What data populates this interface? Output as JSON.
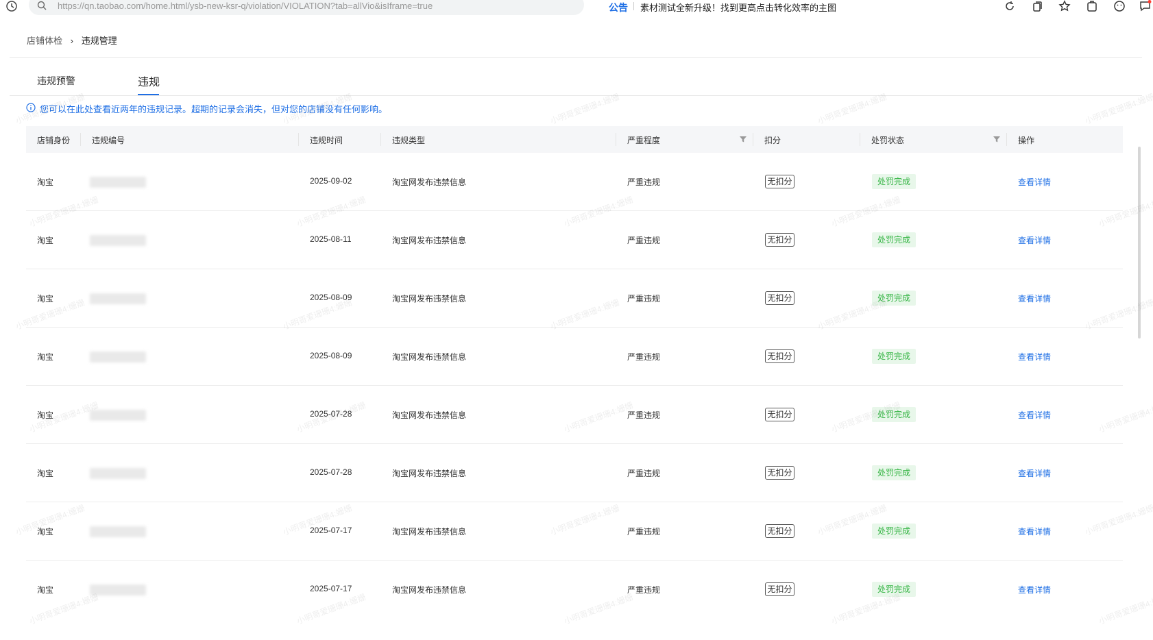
{
  "browser": {
    "url": "https://qn.taobao.com/home.html/ysb-new-ksr-q/violation/VIOLATION?tab=allVio&isIframe=true",
    "notice_label": "公告",
    "notice_text": "素材测试全新升级！找到更高点击转化效率的主图"
  },
  "breadcrumb": {
    "root": "店铺体检",
    "separator": "›",
    "current": "违规管理"
  },
  "tabs": [
    {
      "label": "违规预警",
      "active": false
    },
    {
      "label": "违规",
      "active": true
    }
  ],
  "tip": "您可以在此处查看近两年的违规记录。超期的记录会消失，但对您的店铺没有任何影响。",
  "table": {
    "headers": {
      "identity": "店铺身份",
      "number": "违规编号",
      "time": "违规时间",
      "type": "违规类型",
      "severity": "严重程度",
      "deduct": "扣分",
      "status": "处罚状态",
      "action": "操作"
    },
    "rows": [
      {
        "identity": "淘宝",
        "time": "2025-09-02",
        "type": "淘宝网发布违禁信息",
        "severity": "严重违规",
        "deduct": "无扣分",
        "status": "处罚完成",
        "action": "查看详情"
      },
      {
        "identity": "淘宝",
        "time": "2025-08-11",
        "type": "淘宝网发布违禁信息",
        "severity": "严重违规",
        "deduct": "无扣分",
        "status": "处罚完成",
        "action": "查看详情"
      },
      {
        "identity": "淘宝",
        "time": "2025-08-09",
        "type": "淘宝网发布违禁信息",
        "severity": "严重违规",
        "deduct": "无扣分",
        "status": "处罚完成",
        "action": "查看详情"
      },
      {
        "identity": "淘宝",
        "time": "2025-08-09",
        "type": "淘宝网发布违禁信息",
        "severity": "严重违规",
        "deduct": "无扣分",
        "status": "处罚完成",
        "action": "查看详情"
      },
      {
        "identity": "淘宝",
        "time": "2025-07-28",
        "type": "淘宝网发布违禁信息",
        "severity": "严重违规",
        "deduct": "无扣分",
        "status": "处罚完成",
        "action": "查看详情"
      },
      {
        "identity": "淘宝",
        "time": "2025-07-28",
        "type": "淘宝网发布违禁信息",
        "severity": "严重违规",
        "deduct": "无扣分",
        "status": "处罚完成",
        "action": "查看详情"
      },
      {
        "identity": "淘宝",
        "time": "2025-07-17",
        "type": "淘宝网发布违禁信息",
        "severity": "严重违规",
        "deduct": "无扣分",
        "status": "处罚完成",
        "action": "查看详情"
      },
      {
        "identity": "淘宝",
        "time": "2025-07-17",
        "type": "淘宝网发布违禁信息",
        "severity": "严重违规",
        "deduct": "无扣分",
        "status": "处罚完成",
        "action": "查看详情"
      }
    ]
  },
  "watermark": "小明哥爱珊珊4:姗姗",
  "colors": {
    "primary": "#1f6fe5",
    "success_text": "#34b443",
    "success_bg": "#e8f7ea",
    "header_bg": "#f5f6f8"
  },
  "icons": [
    "history-icon",
    "search-icon",
    "refresh-icon",
    "copy-icon",
    "star-icon",
    "extension-icon",
    "smile-icon",
    "chat-icon",
    "info-icon",
    "filter-icon"
  ]
}
